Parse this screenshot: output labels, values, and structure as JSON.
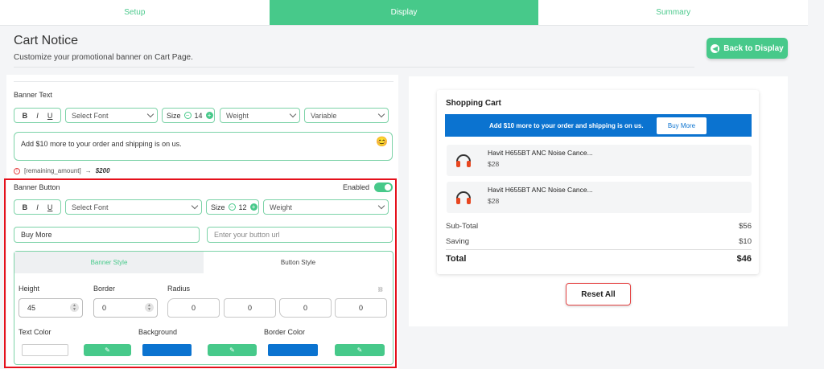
{
  "tabs": [
    {
      "label": "Setup",
      "active": false
    },
    {
      "label": "Display",
      "active": true
    },
    {
      "label": "Summary",
      "active": false
    }
  ],
  "header": {
    "title": "Cart Notice",
    "subtitle": "Customize your promotional banner on Cart Page.",
    "back_label": "Back to Display"
  },
  "banner_text": {
    "label": "Banner Text",
    "format": {
      "bold": "B",
      "italic": "I",
      "underline": "U"
    },
    "font_select": "Select Font",
    "size_label": "Size",
    "size_value": "14",
    "weight_select": "Weight",
    "variable_select": "Variable",
    "text_value": "Add $10 more to your order and shipping is on us.",
    "emoji": "😊",
    "hint_key": "[remaining_amount]",
    "hint_arrow": "→",
    "hint_value": "$200"
  },
  "banner_button": {
    "label": "Banner Button",
    "enabled_label": "Enabled",
    "format": {
      "bold": "B",
      "italic": "I",
      "underline": "U"
    },
    "font_select": "Select Font",
    "size_label": "Size",
    "size_value": "12",
    "weight_select": "Weight",
    "button_text_value": "Buy More",
    "url_placeholder": "Enter your button url",
    "subtabs": {
      "banner_style": "Banner Style",
      "button_style": "Button Style"
    },
    "height_label": "Height",
    "height_value": "45",
    "border_label": "Border",
    "border_value": "0",
    "radius_label": "Radius",
    "radius_values": [
      "0",
      "0",
      "0",
      "0"
    ],
    "text_color_label": "Text Color",
    "background_label": "Background",
    "border_color_label": "Border Color",
    "text_color": "#ffffff",
    "background_color": "#0b73d0",
    "border_color": "#0b73d0",
    "accent_color": "#47c98a"
  },
  "preview": {
    "cart_title": "Shopping Cart",
    "banner_text": "Add $10 more to your order and shipping is on us.",
    "banner_button": "Buy More",
    "items": [
      {
        "name": "Havit H655BT ANC Noise Cance...",
        "price": "$28",
        "icon": "headphones-icon"
      },
      {
        "name": "Havit H655BT ANC Noise Cance...",
        "price": "$28",
        "icon": "headphones-icon"
      }
    ],
    "subtotal_label": "Sub-Total",
    "subtotal_value": "$56",
    "saving_label": "Saving",
    "saving_value": "$10",
    "total_label": "Total",
    "total_value": "$46",
    "reset_label": "Reset All"
  }
}
